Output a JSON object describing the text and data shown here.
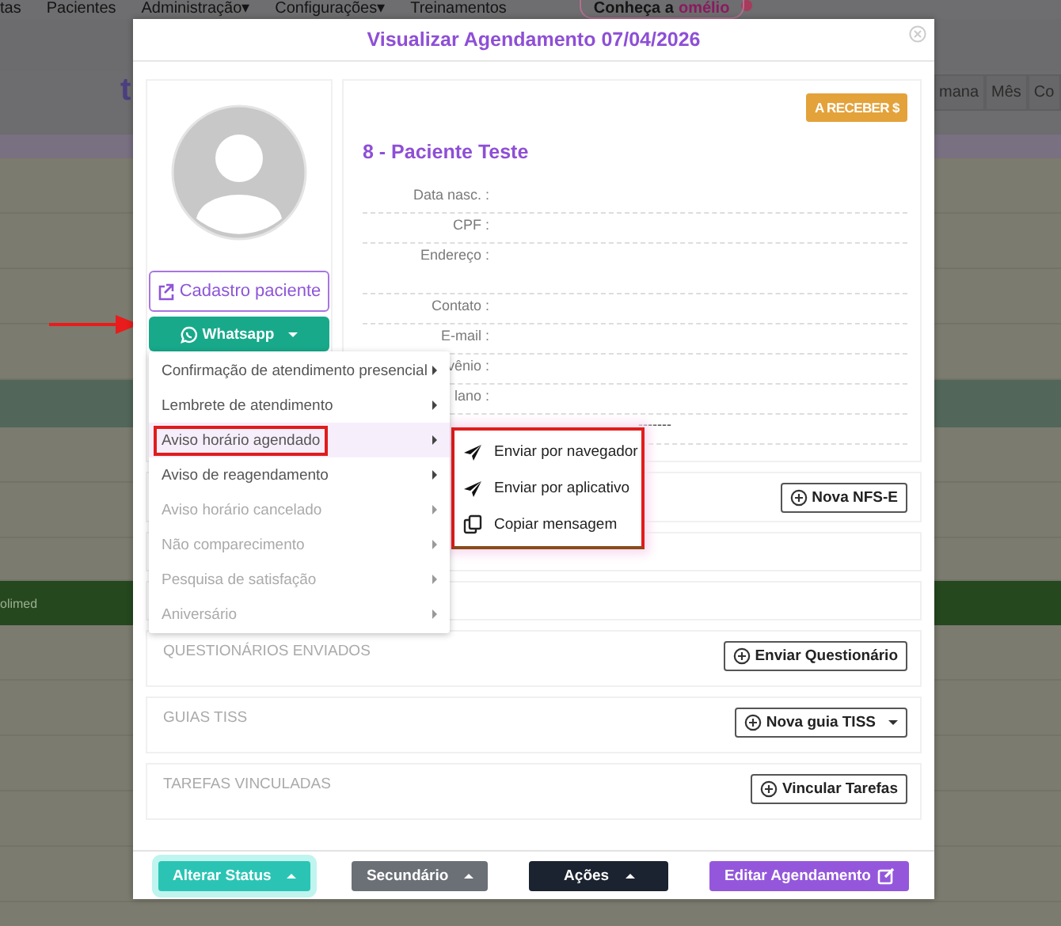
{
  "background": {
    "nav": [
      "tas",
      "Pacientes",
      "Administração▾",
      "Configurações▾",
      "Treinamentos"
    ],
    "promo": {
      "prefix": "Conheça a",
      "brand": "omélio"
    },
    "brand_fragment": "t",
    "view_buttons": [
      "mana",
      "Mês",
      "Co"
    ],
    "event": "olimed"
  },
  "modal": {
    "title": "Visualizar Agendamento 07/04/2026",
    "profile_button": "Cadastro paciente",
    "whatsapp_button": "Whatsapp",
    "patient": {
      "status": "A RECEBER $",
      "name": "8 - Paciente Teste",
      "fields": [
        {
          "kind": "line",
          "label": "Data nasc. :"
        },
        {
          "kind": "line",
          "label": "CPF :"
        },
        {
          "kind": "address",
          "label": "Endereço :"
        },
        {
          "kind": "line",
          "label": "Contato :"
        },
        {
          "kind": "line",
          "label": "E-mail :"
        },
        {
          "kind": "line",
          "label": "vênio :"
        },
        {
          "kind": "line",
          "label": "lano :"
        },
        {
          "kind": "line",
          "value": "-------"
        }
      ]
    },
    "sections": [
      {
        "kind": "action",
        "action": {
          "label": "Nova NFS-E",
          "dropdown": false
        }
      },
      {
        "kind": "blank"
      },
      {
        "kind": "blank"
      },
      {
        "kind": "titled",
        "title": "QUESTIONÁRIOS ENVIADOS",
        "action": {
          "label": "Enviar Questionário",
          "dropdown": false
        }
      },
      {
        "kind": "titled",
        "title": "GUIAS TISS",
        "action": {
          "label": "Nova guia TISS",
          "dropdown": true
        }
      },
      {
        "kind": "titled",
        "title": "TAREFAS VINCULADAS",
        "action": {
          "label": "Vincular Tarefas",
          "dropdown": false
        }
      }
    ],
    "footer": [
      {
        "label": "Alterar Status",
        "kind": "teal",
        "focused": true
      },
      {
        "label": "Secundário",
        "kind": "gray",
        "focused": false
      },
      {
        "label": "Ações",
        "kind": "dark",
        "focused": false
      },
      {
        "label": "Editar Agendamento",
        "kind": "purple",
        "focused": false
      }
    ],
    "whatsapp_menu": [
      {
        "label": "Confirmação de atendimento presencial",
        "selected": false,
        "disabled": false
      },
      {
        "label": "Lembrete de atendimento",
        "selected": false,
        "disabled": false
      },
      {
        "label": "Aviso horário agendado",
        "selected": true,
        "disabled": false
      },
      {
        "label": "Aviso de reagendamento",
        "selected": false,
        "disabled": false
      },
      {
        "label": "Aviso horário cancelado",
        "selected": false,
        "disabled": true
      },
      {
        "label": "Não comparecimento",
        "selected": false,
        "disabled": true
      },
      {
        "label": "Pesquisa de satisfação",
        "selected": false,
        "disabled": true
      },
      {
        "label": "Aniversário",
        "selected": false,
        "disabled": true
      }
    ],
    "submenu": [
      {
        "label": "Enviar por navegador",
        "kind": "send"
      },
      {
        "label": "Enviar por aplicativo",
        "kind": "send"
      },
      {
        "label": "Copiar mensagem",
        "kind": "copy"
      }
    ]
  }
}
